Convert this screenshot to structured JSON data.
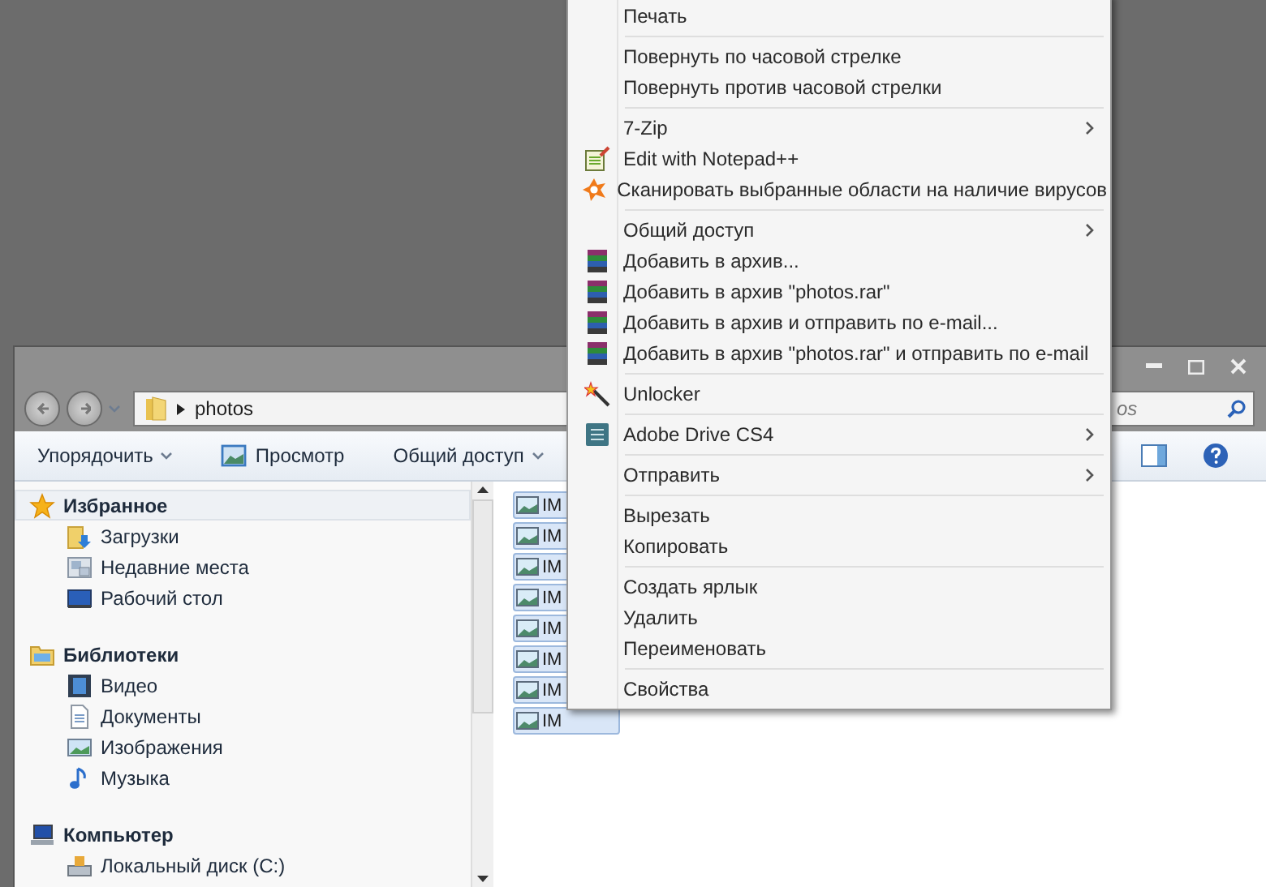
{
  "window": {
    "address": {
      "path": "photos"
    },
    "search": {
      "placeholder": "os"
    },
    "toolbar": {
      "buttons": [
        {
          "label": "Упорядочить",
          "dropdown": true,
          "kind": "plain"
        },
        {
          "label": "Просмотр",
          "dropdown": false,
          "kind": "preview"
        },
        {
          "label": "Общий доступ",
          "dropdown": true,
          "kind": "plain"
        }
      ]
    },
    "navigation": [
      {
        "label": "Избранное",
        "kind": "favorites",
        "selected": true,
        "children": [
          {
            "label": "Загрузки",
            "kind": "downloads",
            "selected": false
          },
          {
            "label": "Недавние места",
            "kind": "recent",
            "selected": false
          },
          {
            "label": "Рабочий стол",
            "kind": "desktop",
            "selected": false
          }
        ]
      },
      {
        "label": "Библиотеки",
        "kind": "libraries",
        "selected": false,
        "children": [
          {
            "label": "Видео",
            "kind": "video",
            "selected": false
          },
          {
            "label": "Документы",
            "kind": "documents",
            "selected": false
          },
          {
            "label": "Изображения",
            "kind": "images",
            "selected": false
          },
          {
            "label": "Музыка",
            "kind": "music",
            "selected": false
          }
        ]
      },
      {
        "label": "Компьютер",
        "kind": "computer",
        "selected": false,
        "children": [
          {
            "label": "Локальный диск (C:)",
            "kind": "disk",
            "selected": false
          }
        ]
      }
    ],
    "files": [
      {
        "name": "IM",
        "selected": true
      },
      {
        "name": "IM",
        "selected": true
      },
      {
        "name": "IM",
        "selected": true
      },
      {
        "name": "IM",
        "selected": true
      },
      {
        "name": "IM",
        "selected": true
      },
      {
        "name": "IM",
        "selected": true
      },
      {
        "name": "IM",
        "selected": true
      },
      {
        "name": "IM",
        "selected": true
      }
    ]
  },
  "context_menu": {
    "items": [
      {
        "kind": "plain",
        "label": "Печать",
        "submenu": false
      },
      {
        "kind": "separator"
      },
      {
        "kind": "plain",
        "label": "Повернуть по часовой стрелке",
        "submenu": false
      },
      {
        "kind": "plain",
        "label": "Повернуть против часовой стрелки",
        "submenu": false
      },
      {
        "kind": "separator"
      },
      {
        "kind": "plain",
        "label": "7-Zip",
        "submenu": true
      },
      {
        "kind": "notepad",
        "label": "Edit with Notepad++",
        "submenu": false
      },
      {
        "kind": "antivirus",
        "label": "Сканировать выбранные области на наличие вирусов",
        "submenu": false
      },
      {
        "kind": "separator"
      },
      {
        "kind": "plain",
        "label": "Общий доступ",
        "submenu": true
      },
      {
        "kind": "archive",
        "label": "Добавить в архив...",
        "submenu": false
      },
      {
        "kind": "archive",
        "label": "Добавить в архив \"photos.rar\"",
        "submenu": false
      },
      {
        "kind": "archive",
        "label": "Добавить в архив и отправить по e-mail...",
        "submenu": false
      },
      {
        "kind": "archive",
        "label": "Добавить в архив \"photos.rar\" и отправить по e-mail",
        "submenu": false
      },
      {
        "kind": "separator"
      },
      {
        "kind": "wand",
        "label": "Unlocker",
        "submenu": false
      },
      {
        "kind": "separator"
      },
      {
        "kind": "drive",
        "label": "Adobe Drive CS4",
        "submenu": true
      },
      {
        "kind": "separator"
      },
      {
        "kind": "plain",
        "label": "Отправить",
        "submenu": true
      },
      {
        "kind": "separator"
      },
      {
        "kind": "plain",
        "label": "Вырезать",
        "submenu": false
      },
      {
        "kind": "plain",
        "label": "Копировать",
        "submenu": false
      },
      {
        "kind": "separator"
      },
      {
        "kind": "plain",
        "label": "Создать ярлык",
        "submenu": false
      },
      {
        "kind": "plain",
        "label": "Удалить",
        "submenu": false
      },
      {
        "kind": "plain",
        "label": "Переименовать",
        "submenu": false
      },
      {
        "kind": "separator"
      },
      {
        "kind": "plain",
        "label": "Свойства",
        "submenu": false
      }
    ]
  }
}
